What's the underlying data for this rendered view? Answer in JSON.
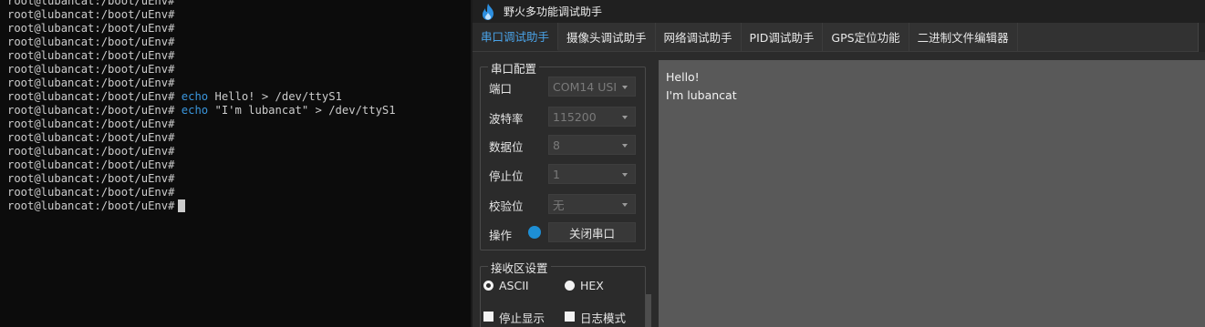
{
  "terminal": {
    "prompt": "root@lubancat:/boot/uEnv#",
    "lines": [
      {
        "prompt": "root@lubancat:/boot/uEnv#",
        "cmd": "",
        "args": ""
      },
      {
        "prompt": "root@lubancat:/boot/uEnv#",
        "cmd": "",
        "args": ""
      },
      {
        "prompt": "root@lubancat:/boot/uEnv#",
        "cmd": "",
        "args": ""
      },
      {
        "prompt": "root@lubancat:/boot/uEnv#",
        "cmd": "",
        "args": ""
      },
      {
        "prompt": "root@lubancat:/boot/uEnv#",
        "cmd": "",
        "args": ""
      },
      {
        "prompt": "root@lubancat:/boot/uEnv#",
        "cmd": "",
        "args": ""
      },
      {
        "prompt": "root@lubancat:/boot/uEnv#",
        "cmd": "",
        "args": ""
      },
      {
        "prompt": "root@lubancat:/boot/uEnv#",
        "cmd": "echo",
        "args": " Hello! > /dev/ttyS1"
      },
      {
        "prompt": "root@lubancat:/boot/uEnv#",
        "cmd": "echo",
        "args": " \"I'm lubancat\" > /dev/ttyS1"
      },
      {
        "prompt": "root@lubancat:/boot/uEnv#",
        "cmd": "",
        "args": ""
      },
      {
        "prompt": "root@lubancat:/boot/uEnv#",
        "cmd": "",
        "args": ""
      },
      {
        "prompt": "root@lubancat:/boot/uEnv#",
        "cmd": "",
        "args": ""
      },
      {
        "prompt": "root@lubancat:/boot/uEnv#",
        "cmd": "",
        "args": ""
      },
      {
        "prompt": "root@lubancat:/boot/uEnv#",
        "cmd": "",
        "args": ""
      },
      {
        "prompt": "root@lubancat:/boot/uEnv#",
        "cmd": "",
        "args": ""
      },
      {
        "prompt": "root@lubancat:/boot/uEnv#",
        "cmd": "",
        "args": ""
      }
    ]
  },
  "app": {
    "title": "野火多功能调试助手",
    "logo_icon": "flame-icon",
    "tabs": [
      {
        "label": "串口调试助手",
        "active": true
      },
      {
        "label": "摄像头调试助手",
        "active": false
      },
      {
        "label": "网络调试助手",
        "active": false
      },
      {
        "label": "PID调试助手",
        "active": false
      },
      {
        "label": "GPS定位功能",
        "active": false
      },
      {
        "label": "二进制文件编辑器",
        "active": false
      }
    ],
    "serial_config": {
      "title": "串口配置",
      "port_label": "端口",
      "port_value": "COM14 USI",
      "baud_label": "波特率",
      "baud_value": "115200",
      "databits_label": "数据位",
      "databits_value": "8",
      "stopbits_label": "停止位",
      "stopbits_value": "1",
      "parity_label": "校验位",
      "parity_value": "无",
      "action_label": "操作",
      "close_button": "关闭串口",
      "status_color": "#1e8fd5"
    },
    "receive_settings": {
      "title": "接收区设置",
      "ascii_label": "ASCII",
      "hex_label": "HEX",
      "ascii_checked": true,
      "stop_display_label": "停止显示",
      "log_mode_label": "日志模式"
    },
    "receive_area": {
      "line1": "Hello!",
      "line2": "I'm lubancat"
    },
    "accent_color": "#4aa3e8"
  }
}
